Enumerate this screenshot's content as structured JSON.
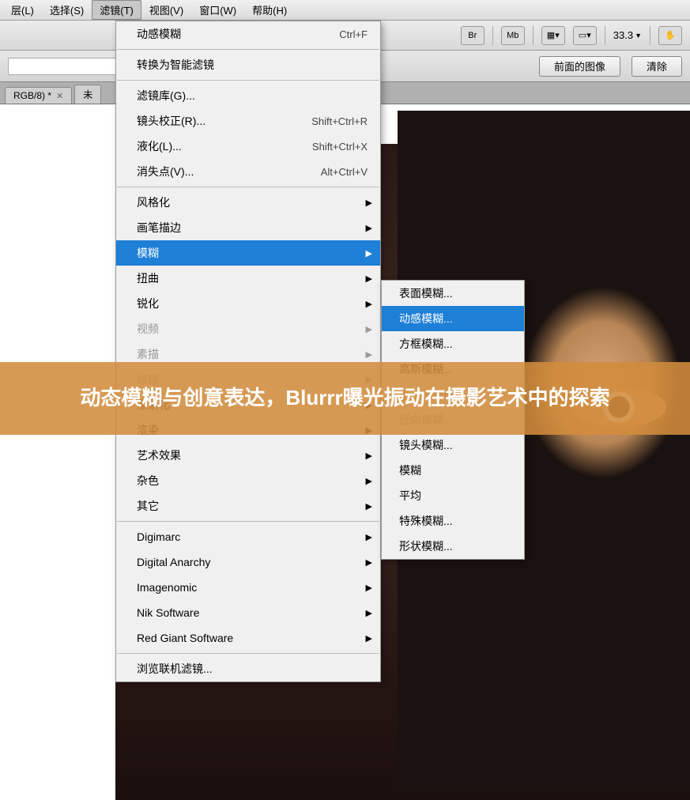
{
  "menubar": {
    "items": [
      "层(L)",
      "选择(S)",
      "滤镜(T)",
      "视图(V)",
      "窗口(W)",
      "帮助(H)"
    ],
    "active_index": 2
  },
  "toolbar": {
    "icons": [
      "Br",
      "Mb"
    ],
    "zoom_value": "33.3",
    "zoom_arrow": "▼"
  },
  "optbar": {
    "input_value": "",
    "btn_front": "前面的图像",
    "btn_clear": "清除"
  },
  "tabbar": {
    "tab1": "RGB/8) *",
    "tab2_prefix": "未"
  },
  "filter_menu": {
    "recent": {
      "label": "动感模糊",
      "shortcut": "Ctrl+F"
    },
    "smart": "转换为智能滤镜",
    "group1": [
      {
        "label": "滤镜库(G)...",
        "shortcut": ""
      },
      {
        "label": "镜头校正(R)...",
        "shortcut": "Shift+Ctrl+R"
      },
      {
        "label": "液化(L)...",
        "shortcut": "Shift+Ctrl+X"
      },
      {
        "label": "消失点(V)...",
        "shortcut": "Alt+Ctrl+V"
      }
    ],
    "group2": [
      {
        "label": "风格化",
        "submenu": true
      },
      {
        "label": "画笔描边",
        "submenu": true
      },
      {
        "label": "模糊",
        "submenu": true,
        "selected": true
      },
      {
        "label": "扭曲",
        "submenu": true
      },
      {
        "label": "锐化",
        "submenu": true
      },
      {
        "label": "视频",
        "submenu": true,
        "disabled": true
      },
      {
        "label": "素描",
        "submenu": true,
        "disabled": true
      },
      {
        "label": "纹理",
        "submenu": true,
        "disabled": true
      },
      {
        "label": "像素化",
        "submenu": true
      },
      {
        "label": "渲染",
        "submenu": true
      },
      {
        "label": "艺术效果",
        "submenu": true
      },
      {
        "label": "杂色",
        "submenu": true
      },
      {
        "label": "其它",
        "submenu": true
      }
    ],
    "group3": [
      {
        "label": "Digimarc",
        "submenu": true
      },
      {
        "label": "Digital Anarchy",
        "submenu": true
      },
      {
        "label": "Imagenomic",
        "submenu": true
      },
      {
        "label": "Nik Software",
        "submenu": true
      },
      {
        "label": "Red Giant Software",
        "submenu": true
      }
    ],
    "browse": "浏览联机滤镜..."
  },
  "blur_submenu": [
    {
      "label": "表面模糊..."
    },
    {
      "label": "动感模糊...",
      "selected": true
    },
    {
      "label": "方框模糊..."
    },
    {
      "label": "高斯模糊...",
      "hidden_by_overlay": true
    },
    {
      "label": "进一步模糊",
      "disabled": true
    },
    {
      "label": "径向模糊...",
      "disabled": true
    },
    {
      "label": "镜头模糊..."
    },
    {
      "label": "模糊"
    },
    {
      "label": "平均"
    },
    {
      "label": "特殊模糊..."
    },
    {
      "label": "形状模糊..."
    }
  ],
  "overlay_text": "动态模糊与创意表达，Blurrr曝光振动在摄影艺术中的探索"
}
